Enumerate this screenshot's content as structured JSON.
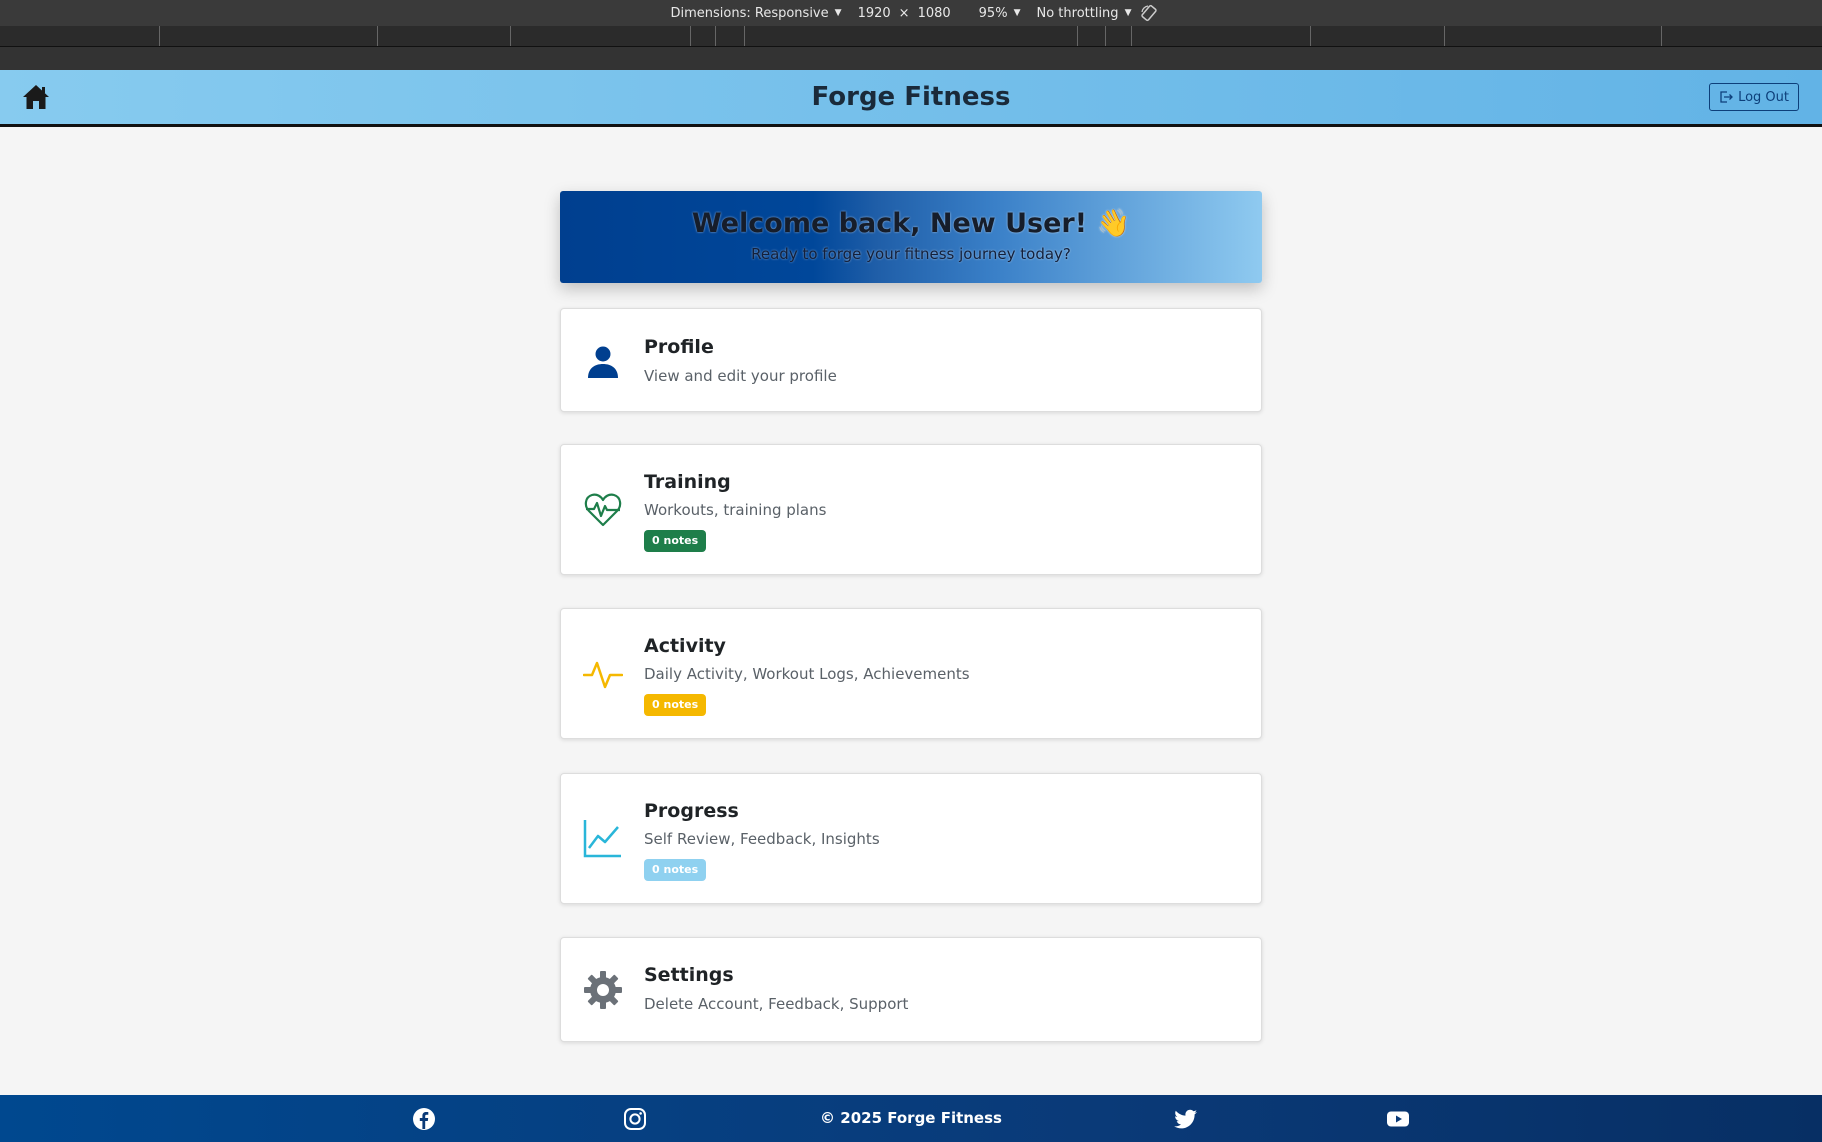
{
  "devtools": {
    "dimensions_label": "Dimensions: Responsive",
    "width": "1920",
    "times": "×",
    "height": "1080",
    "zoom": "95%",
    "throttling": "No throttling"
  },
  "header": {
    "title": "Forge Fitness",
    "logout_label": "Log Out"
  },
  "welcome": {
    "title": "Welcome back, New User! 👋",
    "subtitle": "Ready to forge your fitness journey today?"
  },
  "cards": [
    {
      "title": "Profile",
      "description": "View and edit your profile",
      "icon": "user-icon"
    },
    {
      "title": "Training",
      "description": "Workouts, training plans",
      "badge": "0 notes",
      "badge_color": "#1e7e4a",
      "icon": "heart-pulse-icon"
    },
    {
      "title": "Activity",
      "description": "Daily Activity, Workout Logs, Achievements",
      "badge": "0 notes",
      "badge_color": "#f5b800",
      "icon": "activity-icon"
    },
    {
      "title": "Progress",
      "description": "Self Review, Feedback, Insights",
      "badge": "0 notes",
      "badge_color": "#8fd1f0",
      "icon": "graph-up-icon"
    },
    {
      "title": "Settings",
      "description": "Delete Account, Feedback, Support",
      "icon": "gear-icon"
    }
  ],
  "footer": {
    "copyright": "© 2025 Forge Fitness",
    "icons": [
      "facebook-icon",
      "instagram-icon",
      "twitter-icon",
      "youtube-icon"
    ]
  },
  "colors": {
    "header_gradient_start": "#87cbef",
    "header_gradient_end": "#62b3e6",
    "primary_blue": "#003f8f",
    "training_green": "#1e7e4a",
    "activity_yellow": "#f5b800",
    "progress_cyan": "#29b6d9",
    "settings_gray": "#6b7178"
  }
}
